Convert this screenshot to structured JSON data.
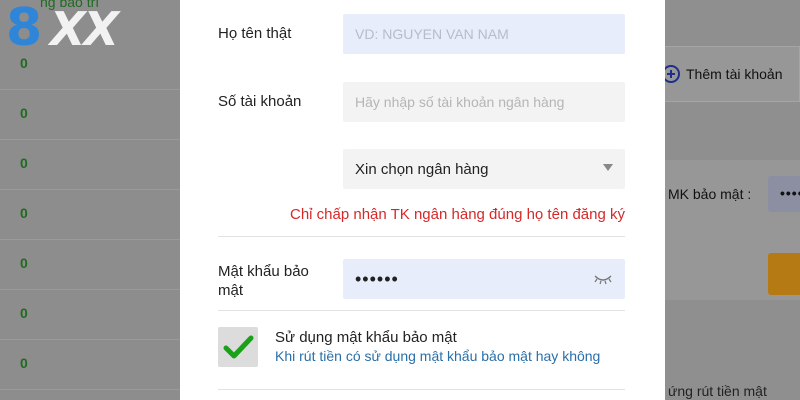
{
  "logo": {
    "digit": "8",
    "letters": "XX"
  },
  "background": {
    "top_partial_text": "ng bảo trì",
    "row_values": [
      "0",
      "0",
      "0",
      "0",
      "0",
      "0",
      "0"
    ],
    "add_account_label": "Thêm tài khoản",
    "security_password_label": "MK bảo mật :",
    "security_password_value": "••••",
    "bottom_partial_text": "ứng rút tiền mật"
  },
  "form": {
    "full_name": {
      "label": "Họ tên thật",
      "placeholder": "VD: NGUYEN VAN NAM"
    },
    "account_number": {
      "label": "Số tài khoản",
      "placeholder": "Hãy nhập số tài khoản ngân hàng"
    },
    "bank_select": {
      "value": "Xin chọn ngân hàng"
    },
    "notice": "Chỉ chấp nhận TK ngân hàng đúng họ tên đăng ký",
    "security_password": {
      "label_line1": "Mật khẩu bảo",
      "label_line2": "mật",
      "value": "••••••"
    },
    "use_security_password": {
      "title": "Sử dụng mật khẩu bảo mật",
      "subtitle": "Khi rút tiền có sử dụng mật khẩu bảo mật hay không",
      "checked": true
    }
  },
  "colors": {
    "accent_blue": "#2f86d8",
    "notice_red": "#d62828",
    "check_green": "#1aa11a",
    "link_blue": "#2a6fa8"
  }
}
